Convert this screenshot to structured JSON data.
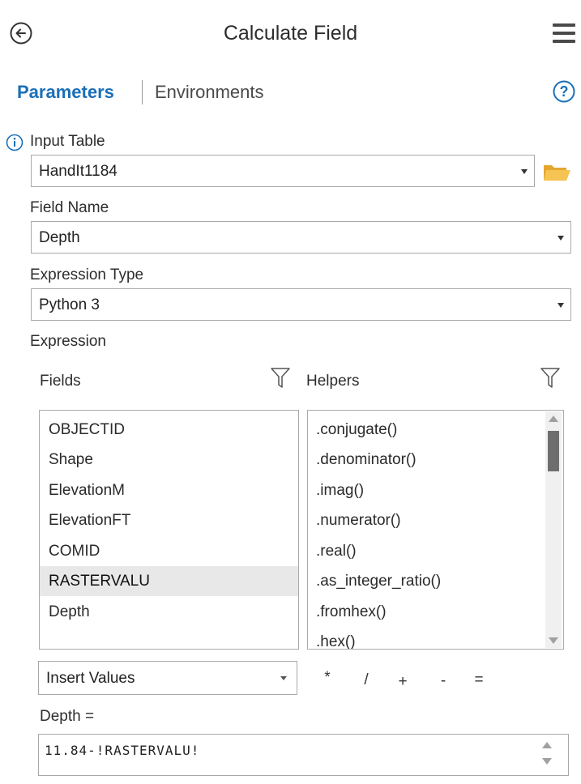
{
  "header": {
    "title": "Calculate Field"
  },
  "tabs": {
    "parameters": "Parameters",
    "environments": "Environments"
  },
  "input_table": {
    "label": "Input Table",
    "value": "HandIt1184"
  },
  "field_name": {
    "label": "Field Name",
    "value": "Depth"
  },
  "expression_type": {
    "label": "Expression Type",
    "value": "Python 3"
  },
  "expression": {
    "label": "Expression",
    "fields_label": "Fields",
    "helpers_label": "Helpers",
    "fields": [
      "OBJECTID",
      "Shape",
      "ElevationM",
      "ElevationFT",
      "COMID",
      "RASTERVALU",
      "Depth"
    ],
    "selected_field": "RASTERVALU",
    "helpers": [
      ".conjugate()",
      ".denominator()",
      ".imag()",
      ".numerator()",
      ".real()",
      ".as_integer_ratio()",
      ".fromhex()",
      ".hex()"
    ],
    "insert_values": "Insert Values",
    "operators": [
      "*",
      "/",
      "+",
      "-",
      "="
    ],
    "target_label": "Depth =",
    "code": "11.84-!RASTERVALU!"
  },
  "colors": {
    "accent": "#1a6fb7",
    "folder": "#f0b73a",
    "selected_row": "#e8e8e8"
  },
  "icons": {
    "back": "back-arrow-icon",
    "menu": "hamburger-menu-icon",
    "help": "help-icon",
    "info": "info-icon",
    "folder": "folder-icon",
    "filter": "filter-icon"
  }
}
